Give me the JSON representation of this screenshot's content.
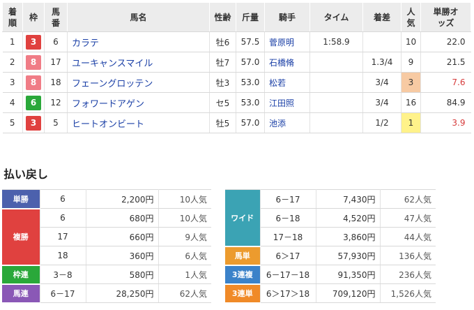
{
  "results": {
    "headers": {
      "rank": "着順",
      "waku": "枠",
      "umaban": "馬番",
      "horse": "馬名",
      "sexage": "性齢",
      "weight": "斤量",
      "jockey": "騎手",
      "time": "タイム",
      "margin": "着差",
      "popularity": "人気",
      "odds": "単勝オッズ"
    },
    "rows": [
      {
        "rank": "1",
        "waku": "3",
        "umaban": "6",
        "horse": "カラテ",
        "sexage": "牡6",
        "weight": "57.5",
        "jockey": "菅原明",
        "time": "1:58.9",
        "margin": "",
        "popularity": "10",
        "odds": "22.0"
      },
      {
        "rank": "2",
        "waku": "8",
        "umaban": "17",
        "horse": "ユーキャンスマイル",
        "sexage": "牡7",
        "weight": "57.0",
        "jockey": "石橋脩",
        "time": "",
        "margin": "1.3/4",
        "popularity": "9",
        "odds": "21.5"
      },
      {
        "rank": "3",
        "waku": "8",
        "umaban": "18",
        "horse": "フェーングロッテン",
        "sexage": "牡3",
        "weight": "53.0",
        "jockey": "松若",
        "time": "",
        "margin": "3/4",
        "popularity": "3",
        "odds": "7.6"
      },
      {
        "rank": "4",
        "waku": "6",
        "umaban": "12",
        "horse": "フォワードアゲン",
        "sexage": "セ5",
        "weight": "53.0",
        "jockey": "江田照",
        "time": "",
        "margin": "3/4",
        "popularity": "16",
        "odds": "84.9"
      },
      {
        "rank": "5",
        "waku": "3",
        "umaban": "5",
        "horse": "ヒートオンビート",
        "sexage": "牡5",
        "weight": "57.0",
        "jockey": "池添",
        "time": "",
        "margin": "1/2",
        "popularity": "1",
        "odds": "3.9"
      }
    ]
  },
  "payout": {
    "title": "払い戻し",
    "left": {
      "tansho": {
        "label": "単勝",
        "rows": [
          {
            "comb": "6",
            "amount": "2,200円",
            "pop": "10人気"
          }
        ]
      },
      "fukusho": {
        "label": "複勝",
        "rows": [
          {
            "comb": "6",
            "amount": "680円",
            "pop": "10人気"
          },
          {
            "comb": "17",
            "amount": "660円",
            "pop": "9人気"
          },
          {
            "comb": "18",
            "amount": "360円",
            "pop": "6人気"
          }
        ]
      },
      "wakuren": {
        "label": "枠連",
        "rows": [
          {
            "comb": "3－8",
            "amount": "580円",
            "pop": "1人気"
          }
        ]
      },
      "umaren": {
        "label": "馬連",
        "rows": [
          {
            "comb": "6－17",
            "amount": "28,250円",
            "pop": "62人気"
          }
        ]
      }
    },
    "right": {
      "wide": {
        "label": "ワイド",
        "rows": [
          {
            "comb": "6－17",
            "amount": "7,430円",
            "pop": "62人気"
          },
          {
            "comb": "6－18",
            "amount": "4,520円",
            "pop": "47人気"
          },
          {
            "comb": "17－18",
            "amount": "3,860円",
            "pop": "44人気"
          }
        ]
      },
      "umatan": {
        "label": "馬単",
        "rows": [
          {
            "comb": "6＞17",
            "amount": "57,930円",
            "pop": "136人気"
          }
        ]
      },
      "sanrenpuku": {
        "label": "3連複",
        "rows": [
          {
            "comb": "6－17－18",
            "amount": "91,350円",
            "pop": "236人気"
          }
        ]
      },
      "sanrentan": {
        "label": "3連単",
        "rows": [
          {
            "comb": "6＞17＞18",
            "amount": "709,120円",
            "pop": "1,526人気"
          }
        ]
      }
    }
  },
  "colors": {
    "waku3": "#e0413f",
    "waku8": "#f07c86",
    "waku6": "#2aa83a",
    "link": "#1a3fa6",
    "fav_odds": "#d63b3b",
    "pop1_bg": "#fff28a",
    "pop3_bg": "#f7caa3"
  }
}
